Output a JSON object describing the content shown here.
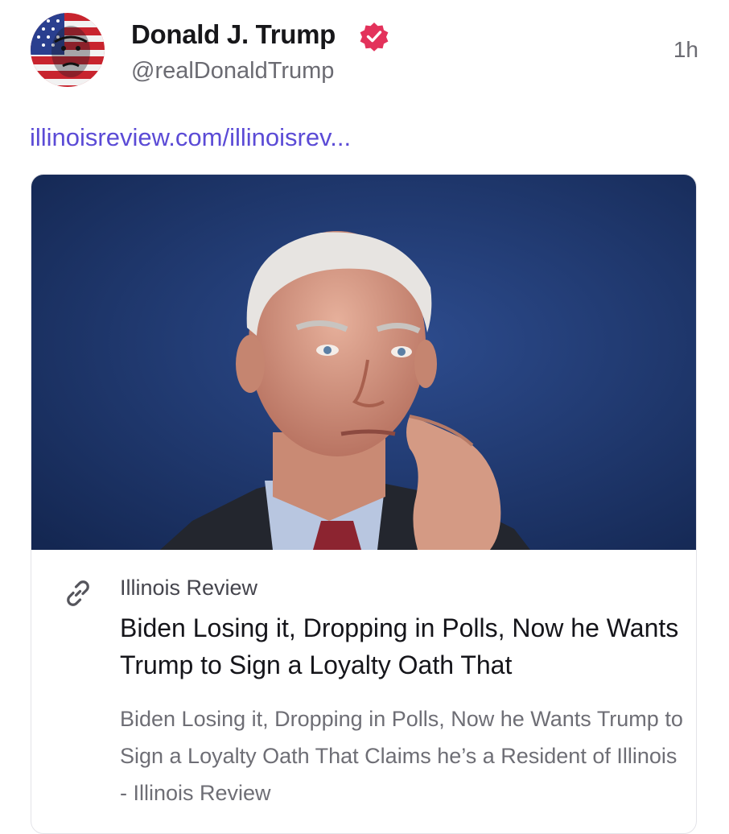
{
  "post": {
    "author": {
      "display_name": "Donald J. Trump",
      "handle": "@realDonaldTrump",
      "verified": true,
      "avatar_icon": "flag-portrait-avatar"
    },
    "timestamp": "1h",
    "link_text": "illinoisreview.com/illinoisrev...",
    "link_preview": {
      "image_icon": "photo-of-man-in-suit",
      "source_icon": "link-icon",
      "source": "Illinois Review",
      "title": "Biden Losing it, Dropping in Polls, Now he Wants Trump to Sign a Loyalty Oath That",
      "description": "Biden Losing it, Dropping in Polls, Now he Wants Trump to Sign a Loyalty Oath That Claims he’s a Resident of Illinois - Illinois Review"
    }
  },
  "colors": {
    "link": "#5b4bd6",
    "verified_badge": "#e3325b",
    "text_primary": "#17171a",
    "text_secondary": "#6b6b72",
    "card_border": "#e3e3e8"
  }
}
